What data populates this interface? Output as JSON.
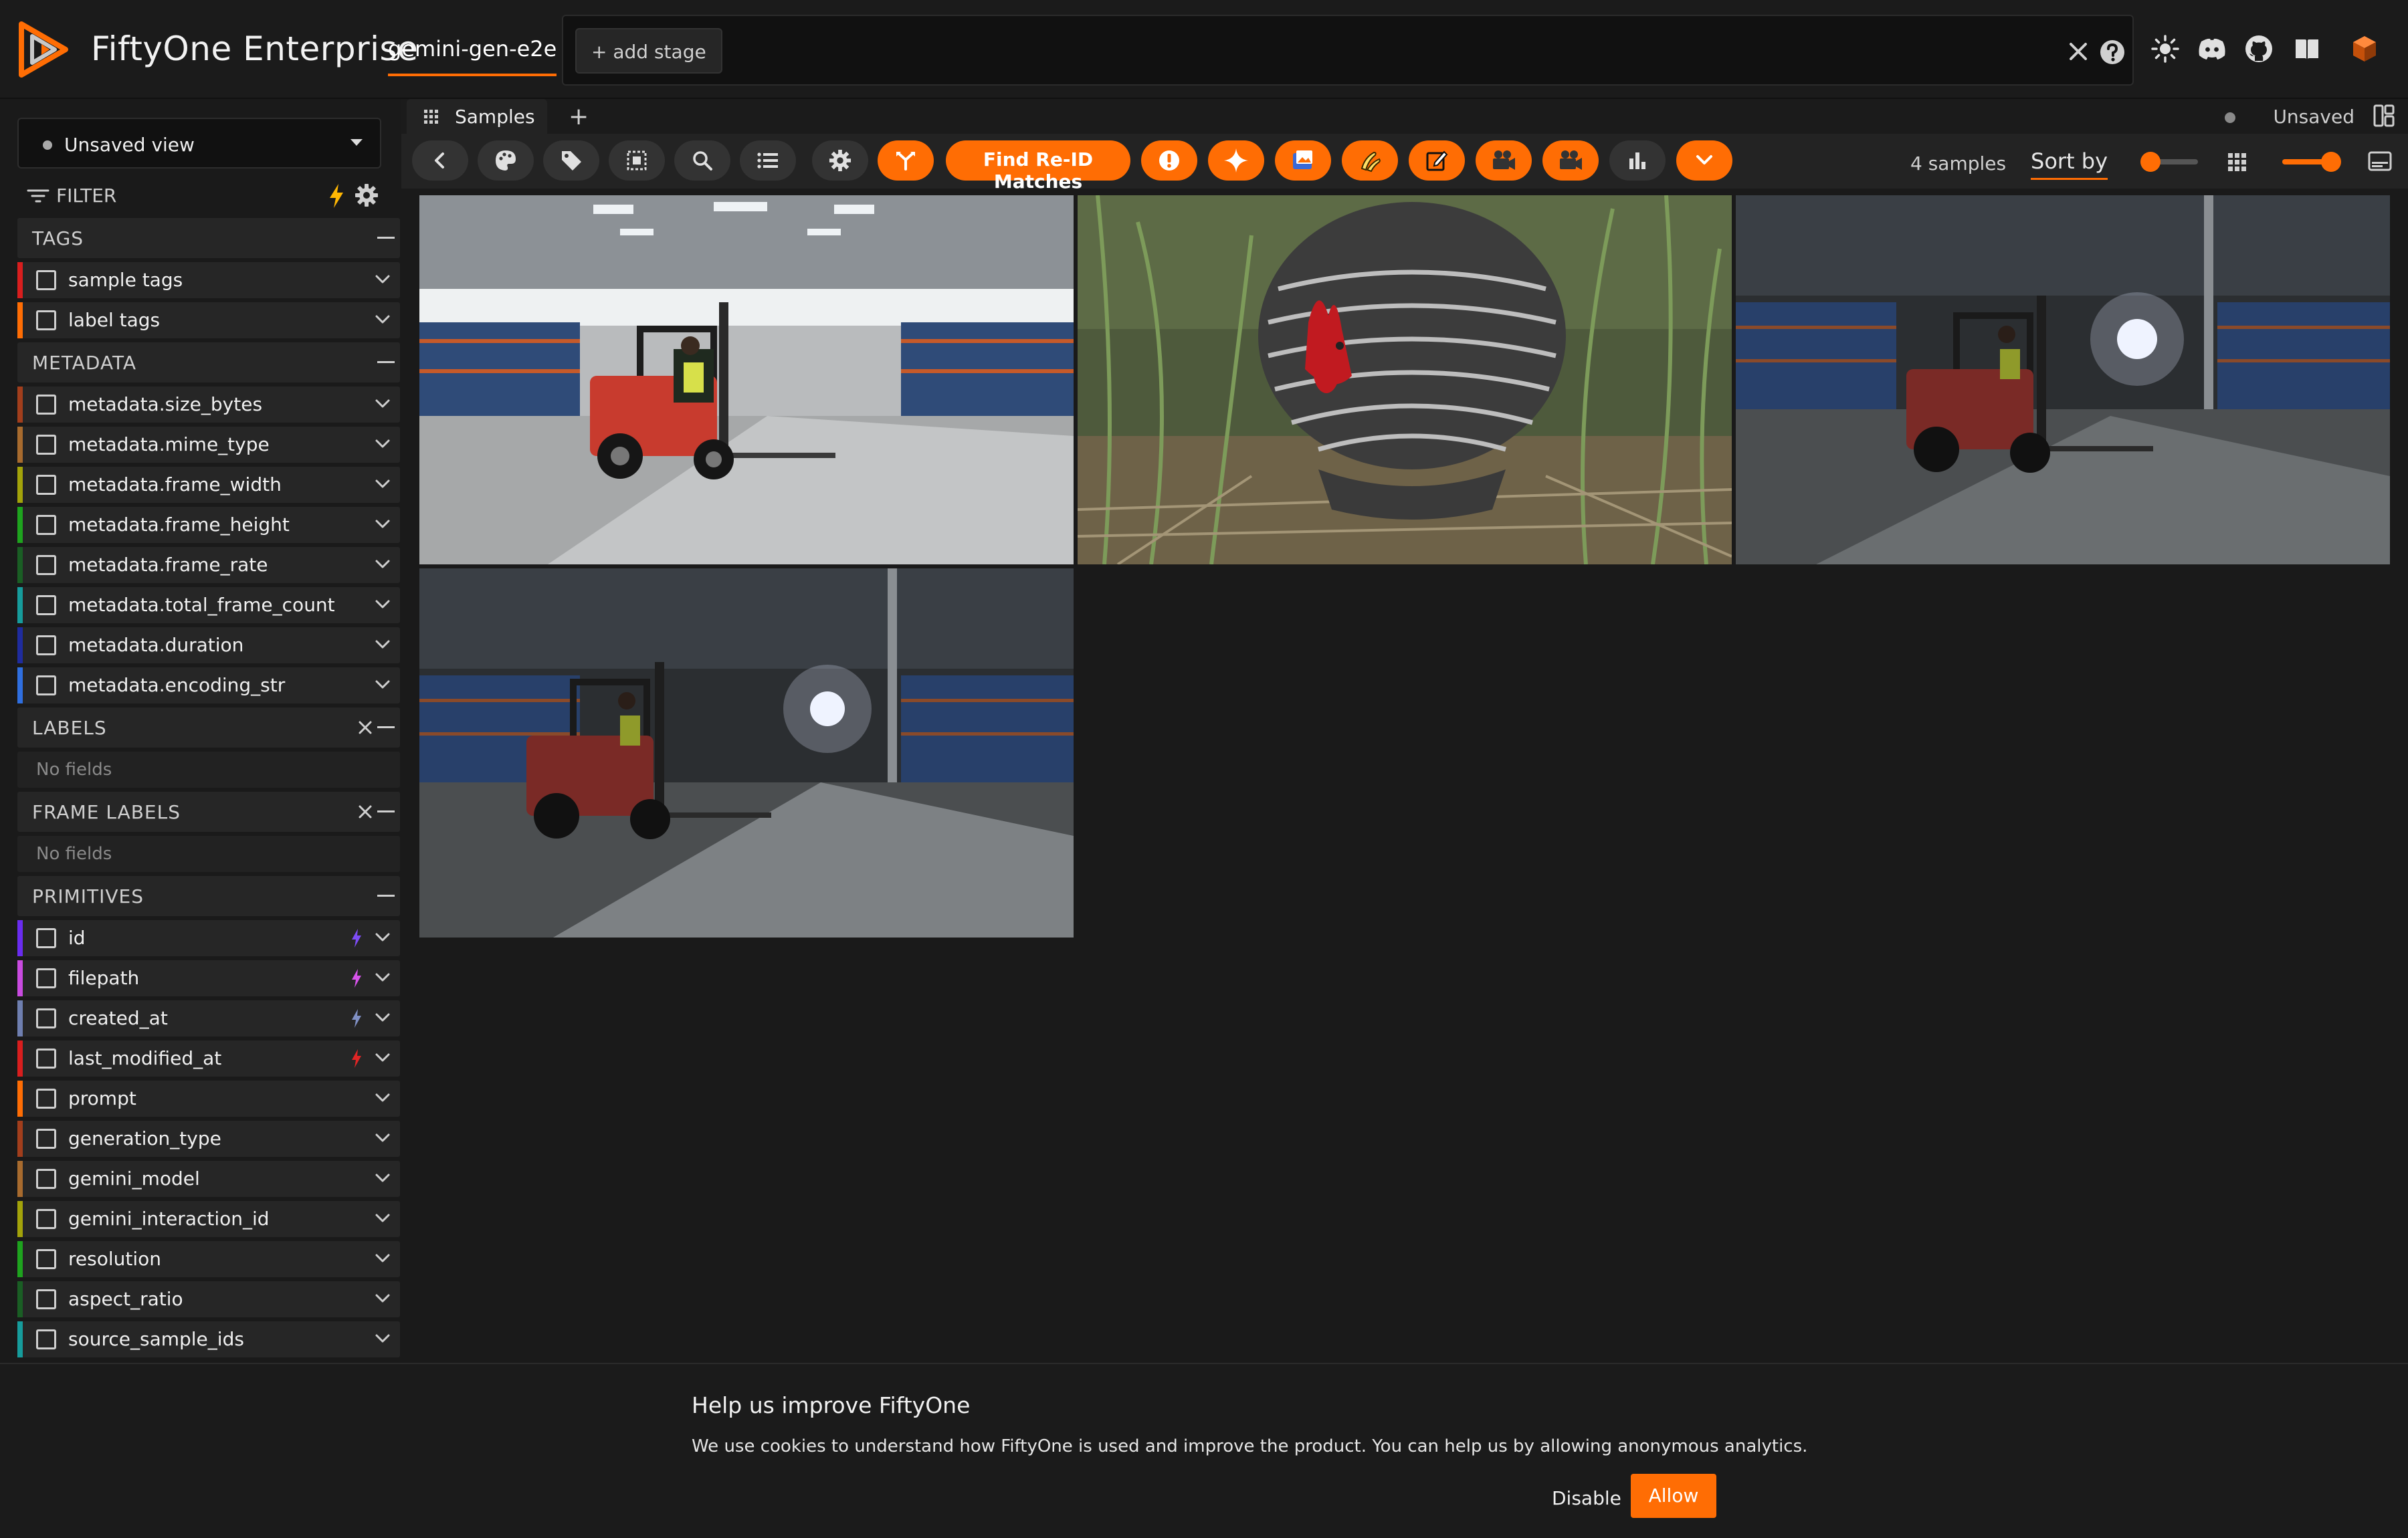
{
  "header": {
    "brand": "FiftyOne Enterprise",
    "dataset_name": "gemini-gen-e2e",
    "add_stage_label": "+ add stage"
  },
  "sidebar": {
    "view_select": "Unsaved view",
    "filter_label": "FILTER",
    "sections": [
      {
        "title": "TAGS",
        "closable": false,
        "rows": [
          {
            "label": "sample tags",
            "color": "#d81e1e"
          },
          {
            "label": "label tags",
            "color": "#ff6d04"
          }
        ]
      },
      {
        "title": "METADATA",
        "closable": false,
        "rows": [
          {
            "label": "metadata.size_bytes",
            "color": "#a23e1c"
          },
          {
            "label": "metadata.mime_type",
            "color": "#a86b2e"
          },
          {
            "label": "metadata.frame_width",
            "color": "#a3a30a"
          },
          {
            "label": "metadata.frame_height",
            "color": "#1ea31e"
          },
          {
            "label": "metadata.frame_rate",
            "color": "#1a5e24"
          },
          {
            "label": "metadata.total_frame_count",
            "color": "#169c9c"
          },
          {
            "label": "metadata.duration",
            "color": "#1f2c9e"
          },
          {
            "label": "metadata.encoding_str",
            "color": "#2f6fe0"
          }
        ]
      },
      {
        "title": "LABELS",
        "closable": true,
        "empty": "No fields",
        "rows": []
      },
      {
        "title": "FRAME LABELS",
        "closable": true,
        "empty": "No fields",
        "rows": []
      },
      {
        "title": "PRIMITIVES",
        "closable": false,
        "rows": [
          {
            "label": "id",
            "color": "#6a2cf0",
            "bolt": "#7d4cf5"
          },
          {
            "label": "filepath",
            "color": "#c94be0",
            "bolt": "#d653ea"
          },
          {
            "label": "created_at",
            "color": "#6f7fb0",
            "bolt": "#8090c4"
          },
          {
            "label": "last_modified_at",
            "color": "#d81e1e",
            "bolt": "#e02525"
          },
          {
            "label": "prompt",
            "color": "#ff6d04"
          },
          {
            "label": "generation_type",
            "color": "#a23e1c"
          },
          {
            "label": "gemini_model",
            "color": "#a86b2e"
          },
          {
            "label": "gemini_interaction_id",
            "color": "#a3a30a"
          },
          {
            "label": "resolution",
            "color": "#1ea31e"
          },
          {
            "label": "aspect_ratio",
            "color": "#1a5e24"
          },
          {
            "label": "source_sample_ids",
            "color": "#169c9c"
          }
        ]
      }
    ]
  },
  "tabs": {
    "samples_label": "Samples",
    "add_label": "+",
    "status": "Unsaved"
  },
  "toolbar": {
    "reid_label": "Find Re-ID Matches",
    "sample_count": "4 samples",
    "sort_label": "Sort by",
    "accent": "#ff6d04"
  },
  "grid": {
    "samples": [
      {
        "scene": "forklift-warehouse-bright"
      },
      {
        "scene": "chicken-in-grass"
      },
      {
        "scene": "forklift-warehouse-dark"
      },
      {
        "scene": "forklift-warehouse-dark-2"
      }
    ]
  },
  "banner": {
    "title": "Help us improve FiftyOne",
    "text": "We use cookies to understand how FiftyOne is used and improve the product. You can help us by allowing anonymous analytics.",
    "disable_label": "Disable",
    "allow_label": "Allow"
  }
}
